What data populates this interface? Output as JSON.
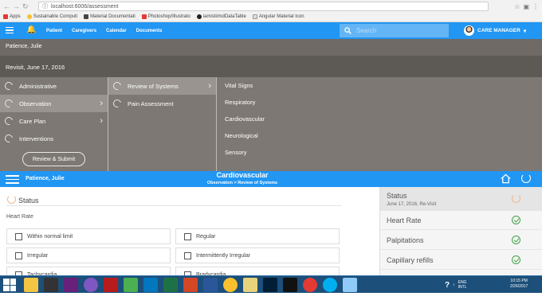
{
  "browser": {
    "url": "localhost:6006/assessment",
    "bookmarks": [
      "Apps",
      "Sustainable Computi",
      "Material Documentati",
      "Photoshop/Illustrato",
      "iamisti/mdDataTable",
      "Angular Material Icon"
    ]
  },
  "appbar": {
    "nav": [
      "Patient",
      "Caregivers",
      "Calendar",
      "Documents"
    ],
    "search_placeholder": "Search",
    "user": "CARE MANAGER"
  },
  "patient_name": "Patience, Julie",
  "visit_label": "Revisit, June 17, 2016",
  "menu": {
    "col1": [
      "Administrative",
      "Observation",
      "Care Plan",
      "Interventions"
    ],
    "col2": [
      "Review of Systems",
      "Pain Assessment"
    ],
    "col3": [
      "Vital Signs",
      "Respiratory",
      "Cardiovascular",
      "Neurological",
      "Sensory"
    ],
    "review_button": "Review & Submit"
  },
  "context": {
    "patient": "Patience, Julie",
    "title": "Cardiovascular",
    "breadcrumb": "Observation > Review of Systems"
  },
  "main": {
    "status_heading": "Status",
    "heart_rate_label": "Heart Rate",
    "options": [
      "Within normal limit",
      "Regular",
      "Irregular",
      "Intermittently Irregular",
      "Tachycardia",
      "Bradycardia"
    ]
  },
  "right_panel": {
    "title": "Status",
    "subtitle": "June 17, 2016, Re-Visit",
    "items": [
      "Heart Rate",
      "Palpitations",
      "Capillary refills"
    ]
  },
  "taskbar": {
    "lang": "ENG",
    "layout": "INTL",
    "time": "10:15 PM",
    "date": "2/26/2017"
  },
  "colors": {
    "primary_blue": "#2196f3",
    "gray_panel": "#7d7873",
    "check_green": "#43a047"
  }
}
